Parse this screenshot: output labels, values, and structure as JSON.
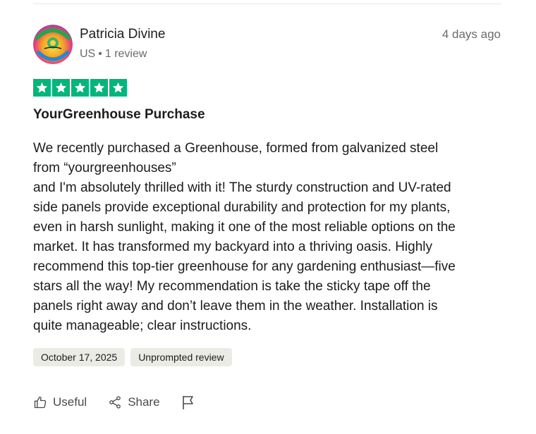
{
  "review": {
    "reviewer": {
      "name": "Patricia Divine",
      "country": "US",
      "separator": "•",
      "review_count": "1 review",
      "avatar_icon": "avatar-image"
    },
    "time_ago": "4 days ago",
    "rating": 5,
    "title": "YourGreenhouse Purchase",
    "body_lines": [
      "We recently purchased a Greenhouse, formed from galvanized steel",
      "from “yourgreenhouses”",
      "and I'm absolutely thrilled with it! The sturdy construction and UV-rated",
      "side panels provide exceptional durability and protection for my plants,",
      "even in harsh sunlight, making it one of the most reliable options on the",
      "market. It has transformed my backyard into a thriving oasis. Highly",
      "recommend this top-tier greenhouse for any gardening enthusiast—five",
      "stars all the way! My recommendation is take the sticky tape off the",
      "panels right away and don’t leave them in the weather. Installation is",
      "quite manageable; clear instructions."
    ],
    "date_tag": "October 17, 2025",
    "type_tag": "Unprompted review"
  },
  "actions": {
    "useful_label": "Useful",
    "share_label": "Share",
    "useful_icon": "thumbs-up-icon",
    "share_icon": "share-icon",
    "flag_icon": "flag-icon"
  },
  "colors": {
    "star_green": "#00b67a",
    "tag_bg": "#ebebe6",
    "muted_text": "#6b6b6b"
  }
}
